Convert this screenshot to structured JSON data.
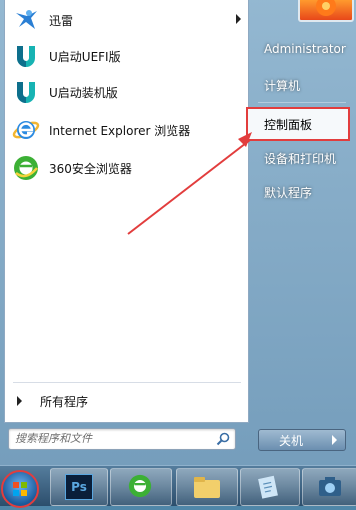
{
  "pinned_programs": [
    {
      "label": "迅雷",
      "icon": "thunder-bird-icon",
      "has_submenu": true
    },
    {
      "label": "U启动UEFI版",
      "icon": "u-start-icon"
    },
    {
      "label": "U启动装机版",
      "icon": "u-start-icon"
    },
    {
      "label": "Internet Explorer 浏览器",
      "icon": "internet-explorer-icon"
    },
    {
      "label": "360安全浏览器",
      "icon": "360-browser-icon"
    }
  ],
  "all_programs_label": "所有程序",
  "search": {
    "placeholder": "搜索程序和文件"
  },
  "right_pane": {
    "user": "Administrator",
    "computer": "计算机",
    "control_panel": "控制面板",
    "devices_printers": "设备和打印机",
    "default_programs": "默认程序"
  },
  "shutdown_label": "关机",
  "taskbar_icons": [
    "windows-start-orb-icon",
    "photoshop-icon",
    "360-browser-icon",
    "folder-icon",
    "notepad-icon",
    "screen-capture-icon"
  ],
  "taskbar_ps_label": "Ps",
  "colors": {
    "highlight_red": "#e23d3d",
    "menu_bg": "#ffffff",
    "accent_blue": "#1a5a9a"
  }
}
